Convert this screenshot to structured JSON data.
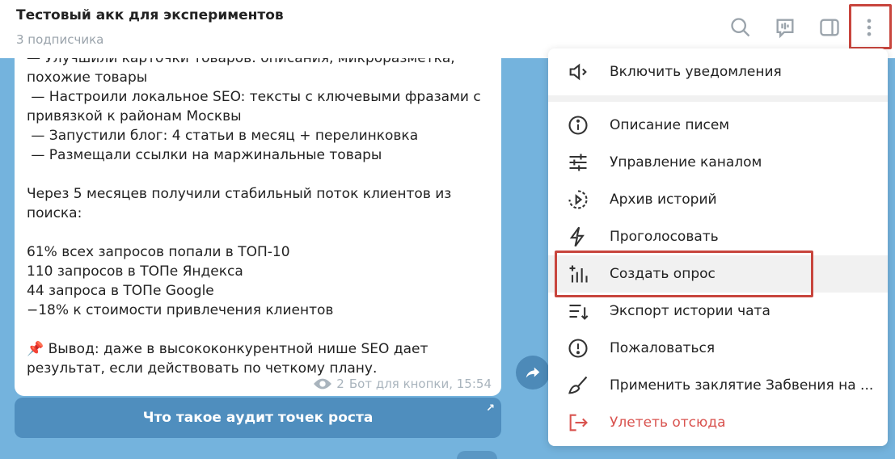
{
  "header": {
    "title": "Тестовый акк для экспериментов",
    "subtitle": "3 подписчика",
    "icons": [
      "search-icon",
      "voice-chat-icon",
      "sidebar-toggle-icon",
      "more-vertical-icon"
    ]
  },
  "message": {
    "lines": [
      "— Улучшили карточки товаров: описания, микроразметка,",
      "похожие товары",
      " — Настроили локальное SEO: тексты с ключевыми фразами с",
      "привязкой к районам Москвы",
      " — Запустили блог: 4 статьи в месяц + перелинковка",
      " — Размещали ссылки на маржинальные товары",
      "",
      "Через 5 месяцев получили стабильный поток клиентов из",
      "поиска:",
      "",
      "61% всех запросов попали в ТОП-10",
      "110 запросов в ТОПе Яндекса",
      "44 запроса в ТОПе Google",
      "−18% к стоимости привлечения клиентов",
      "",
      "📌 Вывод: даже в высококонкурентной нише SEO дает",
      "результат, если действовать по четкому плану."
    ],
    "views": "2",
    "author": "Бот для кнопки, 15:54"
  },
  "inline_button": {
    "label": "Что такое аудит точек роста",
    "arrow": "↗"
  },
  "menu": {
    "items": [
      {
        "label": "Включить уведомления",
        "icon": "speaker-icon"
      },
      {
        "label": "Описание писем",
        "icon": "info-icon"
      },
      {
        "label": "Управление каналом",
        "icon": "settings-sliders-icon"
      },
      {
        "label": "Архив историй",
        "icon": "stories-archive-icon"
      },
      {
        "label": "Проголосовать",
        "icon": "lightning-icon"
      },
      {
        "label": "Создать опрос",
        "icon": "poll-icon"
      },
      {
        "label": "Экспорт истории чата",
        "icon": "export-icon"
      },
      {
        "label": "Пожаловаться",
        "icon": "report-icon"
      },
      {
        "label": "Применить заклятие Забвения на ...",
        "icon": "broom-icon"
      },
      {
        "label": "Улететь отсюда",
        "icon": "leave-icon"
      }
    ]
  },
  "colors": {
    "background": "#74b3dd",
    "accent": "#4f8ebe",
    "danger": "#d9534f",
    "highlight": "#c8453d"
  }
}
